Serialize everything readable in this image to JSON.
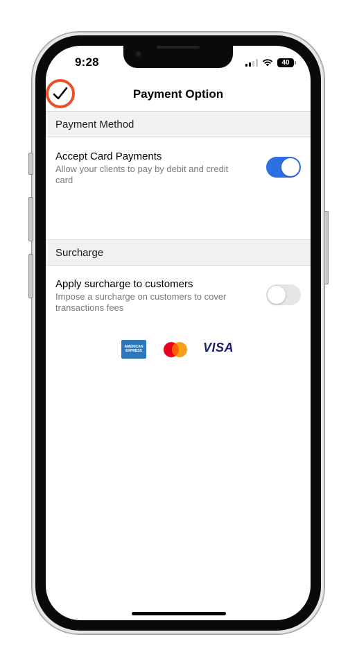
{
  "status_bar": {
    "time": "9:28",
    "battery_level": "40",
    "signal_icon": "cellular-signal-icon",
    "wifi_icon": "wifi-icon"
  },
  "nav": {
    "title": "Payment Option",
    "done_icon": "checkmark-icon",
    "done_highlight_color": "#e8502a"
  },
  "sections": {
    "payment_method": {
      "header": "Payment Method",
      "accept_cards": {
        "title": "Accept Card Payments",
        "description": "Allow your clients to pay by debit and credit card",
        "enabled": true,
        "toggle_color": "#2f6fe4"
      }
    },
    "surcharge": {
      "header": "Surcharge",
      "apply_surcharge": {
        "title": "Apply surcharge to customers",
        "description": "Impose a surcharge on customers to cover transactions fees",
        "enabled": false
      }
    }
  },
  "card_logos": {
    "amex_line1": "AMERICAN",
    "amex_line2": "EXPRESS",
    "visa": "VISA",
    "mastercard_icon": "mastercard-logo-icon"
  }
}
